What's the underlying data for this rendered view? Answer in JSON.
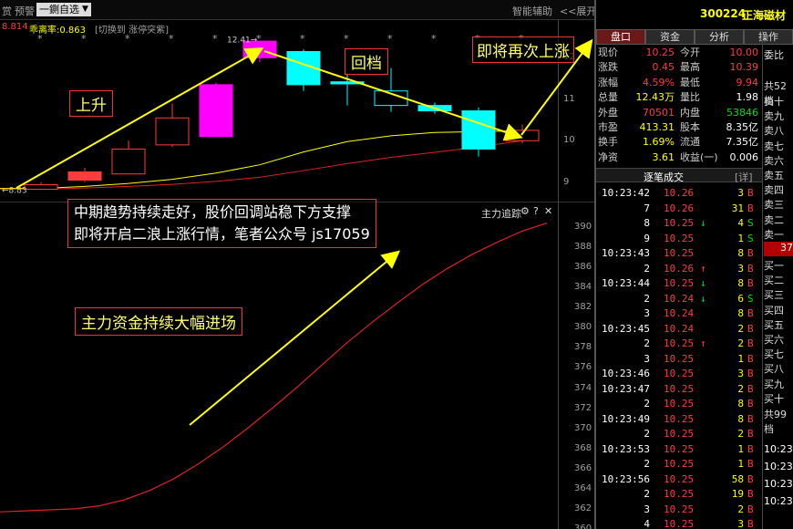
{
  "topbar": {
    "menu_left": "赏",
    "alert_label": "预警",
    "watchlist_label": "一鍘自选",
    "switch_hint": "[切换到 涨停突紫]",
    "smart_assist": "智能辅助",
    "expand_label": "<<展开",
    "ma_label": "8.814",
    "deviation_label": "乖离率:0.863"
  },
  "stock": {
    "code": "300224",
    "name": "正海磁材"
  },
  "tabs": [
    {
      "label": "盘口"
    },
    {
      "label": "资金"
    },
    {
      "label": "分析"
    },
    {
      "label": "操作"
    }
  ],
  "quote": [
    {
      "k1": "现价",
      "v1": "10.25",
      "k2": "今开",
      "v2": "10.00"
    },
    {
      "k1": "涨跌",
      "v1": "0.45",
      "k2": "最高",
      "v2": "10.39"
    },
    {
      "k1": "涨幅",
      "v1": "4.59%",
      "k2": "最低",
      "v2": "9.94"
    },
    {
      "k1": "总量",
      "v1": "12.43万",
      "k2": "量比",
      "v2": "1.98"
    },
    {
      "k1": "外盘",
      "v1": "70501",
      "k2": "内盘",
      "v2": "53846"
    },
    {
      "k1": "市盈",
      "v1": "413.31",
      "k2": "股本",
      "v2": "8.35亿"
    },
    {
      "k1": "换手",
      "v1": "1.69%",
      "k2": "流通",
      "v2": "7.35亿"
    },
    {
      "k1": "净资",
      "v1": "3.61",
      "k2": "收益(一)",
      "v2": "0.006"
    }
  ],
  "ask_panel": {
    "weibi": "委比",
    "header": "共52档",
    "asks": [
      "卖十",
      "卖九",
      "卖八",
      "卖七",
      "卖六",
      "卖五",
      "卖四",
      "卖三",
      "卖二",
      "卖一"
    ],
    "current": "37",
    "bids": [
      "买一",
      "买二",
      "买三",
      "买四",
      "买五",
      "买六",
      "买七",
      "买八",
      "买九",
      "买十"
    ],
    "footer": "共99档",
    "times": [
      "10:23",
      "10:23",
      "10:23",
      "10:23"
    ]
  },
  "ticks_header": {
    "title": "逐笔成交",
    "detail": "[详]"
  },
  "ticks": [
    {
      "time": "10:23:42",
      "price": "10.26",
      "arrow": "",
      "vol": "3",
      "side": "B"
    },
    {
      "time": "7",
      "price": "10.26",
      "arrow": "",
      "vol": "31",
      "side": "B"
    },
    {
      "time": "8",
      "price": "10.25",
      "arrow": "↓",
      "vol": "4",
      "side": "S"
    },
    {
      "time": "9",
      "price": "10.25",
      "arrow": "",
      "vol": "1",
      "side": "S"
    },
    {
      "time": "10:23:43",
      "price": "10.25",
      "arrow": "",
      "vol": "8",
      "side": "B"
    },
    {
      "time": "2",
      "price": "10.26",
      "arrow": "↑",
      "vol": "3",
      "side": "B"
    },
    {
      "time": "10:23:44",
      "price": "10.25",
      "arrow": "↓",
      "vol": "8",
      "side": "B"
    },
    {
      "time": "2",
      "price": "10.24",
      "arrow": "↓",
      "vol": "6",
      "side": "S"
    },
    {
      "time": "3",
      "price": "10.24",
      "arrow": "",
      "vol": "8",
      "side": "B"
    },
    {
      "time": "10:23:45",
      "price": "10.24",
      "arrow": "",
      "vol": "2",
      "side": "B"
    },
    {
      "time": "2",
      "price": "10.25",
      "arrow": "↑",
      "vol": "2",
      "side": "B"
    },
    {
      "time": "3",
      "price": "10.25",
      "arrow": "",
      "vol": "1",
      "side": "B"
    },
    {
      "time": "10:23:46",
      "price": "10.25",
      "arrow": "",
      "vol": "3",
      "side": "B"
    },
    {
      "time": "10:23:47",
      "price": "10.25",
      "arrow": "",
      "vol": "2",
      "side": "B"
    },
    {
      "time": "2",
      "price": "10.25",
      "arrow": "",
      "vol": "8",
      "side": "B"
    },
    {
      "time": "10:23:49",
      "price": "10.25",
      "arrow": "",
      "vol": "8",
      "side": "B"
    },
    {
      "time": "2",
      "price": "10.25",
      "arrow": "",
      "vol": "2",
      "side": "B"
    },
    {
      "time": "10:23:53",
      "price": "10.25",
      "arrow": "",
      "vol": "1",
      "side": "B"
    },
    {
      "time": "2",
      "price": "10.25",
      "arrow": "",
      "vol": "1",
      "side": "B"
    },
    {
      "time": "10:23:56",
      "price": "10.25",
      "arrow": "",
      "vol": "58",
      "side": "B"
    },
    {
      "time": "2",
      "price": "10.25",
      "arrow": "",
      "vol": "19",
      "side": "B"
    },
    {
      "time": "3",
      "price": "10.25",
      "arrow": "",
      "vol": "2",
      "side": "B"
    },
    {
      "time": "4",
      "price": "10.25",
      "arrow": "",
      "vol": "3",
      "side": "B"
    }
  ],
  "annotations": {
    "rise": "上升",
    "pullback": "回档",
    "rise_again": "即将再次上涨",
    "comment_line1": "中期趋势持续走好，股价回调站稳下方支撑",
    "comment_line2": "即将开启二浪上涨行情，笔者公众号 js17059",
    "capital": "主力资金持续大幅进场"
  },
  "capital_panel": {
    "title": "主力追踪"
  },
  "chart_data": [
    {
      "type": "candlestick",
      "title": "",
      "ylim": [
        8.6,
        12.6
      ],
      "y_ticks": [
        "12",
        "11",
        "10",
        "9"
      ],
      "high_label": "12.41",
      "low_label": "8.83",
      "candles": [
        {
          "o": 8.83,
          "c": 8.94,
          "h": 9.0,
          "l": 8.83
        },
        {
          "o": 9.05,
          "c": 9.25,
          "h": 9.35,
          "l": 9.0
        },
        {
          "o": 9.2,
          "c": 9.8,
          "h": 10.0,
          "l": 9.2
        },
        {
          "o": 9.9,
          "c": 10.55,
          "h": 10.9,
          "l": 9.85
        },
        {
          "o": 10.1,
          "c": 11.35,
          "h": 11.4,
          "l": 10.1
        },
        {
          "o": 12.0,
          "c": 12.4,
          "h": 12.41,
          "l": 11.9
        },
        {
          "o": 12.15,
          "c": 11.35,
          "h": 12.2,
          "l": 11.2
        },
        {
          "o": 11.42,
          "c": 11.37,
          "h": 11.6,
          "l": 10.85
        },
        {
          "o": 11.2,
          "c": 10.85,
          "h": 11.75,
          "l": 10.7
        },
        {
          "o": 10.85,
          "c": 10.72,
          "h": 10.92,
          "l": 10.65
        },
        {
          "o": 10.72,
          "c": 9.8,
          "h": 10.8,
          "l": 9.62
        },
        {
          "o": 10.0,
          "c": 10.25,
          "h": 10.39,
          "l": 9.94
        }
      ],
      "ma_yellow": [
        8.85,
        8.9,
        8.97,
        9.07,
        9.22,
        9.42,
        9.73,
        9.98,
        10.12,
        10.2,
        10.22,
        10.24
      ],
      "ma_red": [
        8.83,
        8.86,
        8.9,
        8.95,
        9.02,
        9.12,
        9.28,
        9.45,
        9.6,
        9.72,
        9.85,
        10.0
      ]
    },
    {
      "type": "line",
      "title": "主力追踪",
      "ylim": [
        360,
        391
      ],
      "y_ticks": [
        "390",
        "388",
        "386",
        "384",
        "382",
        "380",
        "378",
        "376",
        "374",
        "372",
        "370",
        "368",
        "366",
        "364",
        "362",
        "360"
      ],
      "series": [
        {
          "values": [
            361.7,
            361.8,
            361.9,
            362.0,
            362.3,
            362.9,
            363.8,
            365.0,
            366.5,
            368.2,
            370.1,
            372.1,
            374.2,
            376.4,
            378.6,
            380.6,
            382.5,
            384.3,
            385.9,
            387.3,
            388.5,
            389.6,
            390.4
          ]
        }
      ]
    }
  ]
}
